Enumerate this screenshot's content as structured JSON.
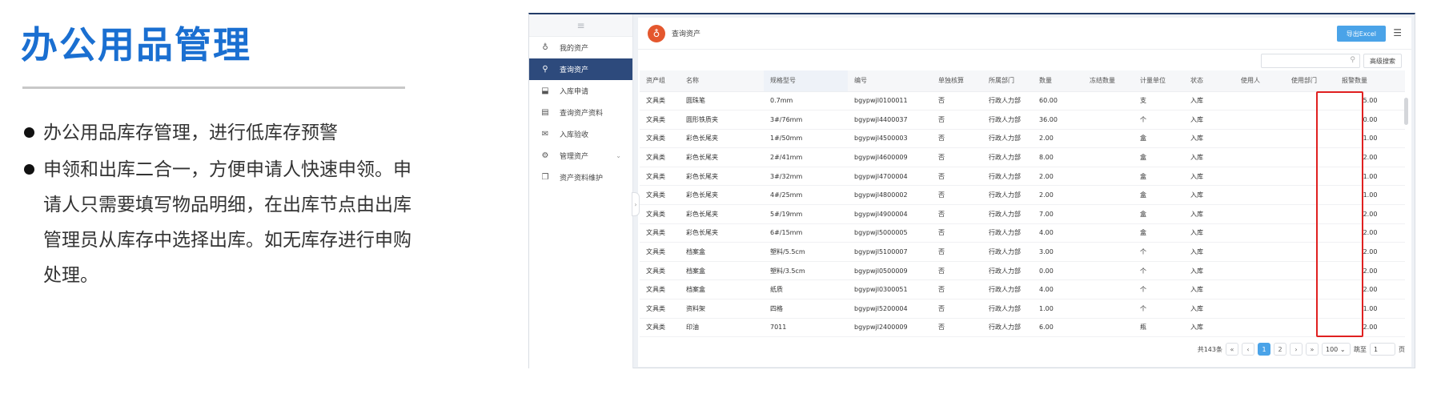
{
  "slide": {
    "title": "办公用品管理",
    "bullets": [
      "办公用品库存管理，进行低库存预警",
      "申领和出库二合一，方便申请人快速申领。申请人只需要填写物品明细，在出库节点由出库管理员从库存中选择出库。如无库存进行申购处理。"
    ]
  },
  "app": {
    "sidebar": {
      "top_icon": "≡",
      "items": [
        {
          "label": "我的资产",
          "icon": "money-bag-icon",
          "glyph": "♁"
        },
        {
          "label": "查询资产",
          "icon": "search-icon",
          "glyph": "⚲",
          "active": true
        },
        {
          "label": "入库申请",
          "icon": "inbox-icon",
          "glyph": "⬓"
        },
        {
          "label": "查询资产资料",
          "icon": "document-icon",
          "glyph": "▤"
        },
        {
          "label": "入库验收",
          "icon": "mail-icon",
          "glyph": "✉"
        },
        {
          "label": "管理资产",
          "icon": "gear-icon",
          "glyph": "⚙",
          "chevron": "⌄"
        },
        {
          "label": "资产资料维护",
          "icon": "files-icon",
          "glyph": "❐"
        }
      ]
    },
    "header": {
      "title": "查询资产",
      "logo_glyph": "♁",
      "export_label": "导出Excel",
      "menu_icon": "☰"
    },
    "search": {
      "placeholder": "",
      "search_icon": "⚲",
      "advanced_label": "高级搜索"
    },
    "table": {
      "columns": [
        "资产组",
        "名称",
        "规格型号",
        "编号",
        "单独核算",
        "所属部门",
        "数量",
        "冻结数量",
        "计量单位",
        "状态",
        "使用人",
        "使用部门",
        "报警数量"
      ],
      "rows": [
        [
          "文具类",
          "圆珠笔",
          "0.7mm",
          "bgypwjl0100011",
          "否",
          "行政人力部",
          "60.00",
          "",
          "支",
          "入库",
          "",
          "",
          "5.00"
        ],
        [
          "文具类",
          "圆形铁质夹",
          "3#/76mm",
          "bgypwjl4400037",
          "否",
          "行政人力部",
          "36.00",
          "",
          "个",
          "入库",
          "",
          "",
          "0.00"
        ],
        [
          "文具类",
          "彩色长尾夹",
          "1#/50mm",
          "bgypwjl4500003",
          "否",
          "行政人力部",
          "2.00",
          "",
          "盒",
          "入库",
          "",
          "",
          "1.00"
        ],
        [
          "文具类",
          "彩色长尾夹",
          "2#/41mm",
          "bgypwjl4600009",
          "否",
          "行政人力部",
          "8.00",
          "",
          "盒",
          "入库",
          "",
          "",
          "2.00"
        ],
        [
          "文具类",
          "彩色长尾夹",
          "3#/32mm",
          "bgypwjl4700004",
          "否",
          "行政人力部",
          "2.00",
          "",
          "盒",
          "入库",
          "",
          "",
          "1.00"
        ],
        [
          "文具类",
          "彩色长尾夹",
          "4#/25mm",
          "bgypwjl4800002",
          "否",
          "行政人力部",
          "2.00",
          "",
          "盒",
          "入库",
          "",
          "",
          "1.00"
        ],
        [
          "文具类",
          "彩色长尾夹",
          "5#/19mm",
          "bgypwjl4900004",
          "否",
          "行政人力部",
          "7.00",
          "",
          "盒",
          "入库",
          "",
          "",
          "2.00"
        ],
        [
          "文具类",
          "彩色长尾夹",
          "6#/15mm",
          "bgypwjl5000005",
          "否",
          "行政人力部",
          "4.00",
          "",
          "盒",
          "入库",
          "",
          "",
          "2.00"
        ],
        [
          "文具类",
          "档案盒",
          "塑料/5.5cm",
          "bgypwjl5100007",
          "否",
          "行政人力部",
          "3.00",
          "",
          "个",
          "入库",
          "",
          "",
          "2.00"
        ],
        [
          "文具类",
          "档案盒",
          "塑料/3.5cm",
          "bgypwjl0500009",
          "否",
          "行政人力部",
          "0.00",
          "",
          "个",
          "入库",
          "",
          "",
          "2.00"
        ],
        [
          "文具类",
          "档案盒",
          "纸质",
          "bgypwjl0300051",
          "否",
          "行政人力部",
          "4.00",
          "",
          "个",
          "入库",
          "",
          "",
          "2.00"
        ],
        [
          "文具类",
          "资料架",
          "四格",
          "bgypwjl5200004",
          "否",
          "行政人力部",
          "1.00",
          "",
          "个",
          "入库",
          "",
          "",
          "1.00"
        ],
        [
          "文具类",
          "印油",
          "7011",
          "bgypwjl2400009",
          "否",
          "行政人力部",
          "6.00",
          "",
          "瓶",
          "入库",
          "",
          "",
          "2.00"
        ]
      ]
    },
    "pager": {
      "total": "共143条",
      "first": "«",
      "prev": "‹",
      "pages": [
        "1",
        "2"
      ],
      "next": "›",
      "last": "»",
      "page_size": "100 ⌄",
      "jump_label": "跳至",
      "jump_value": "1",
      "page_suffix": "页"
    },
    "collapse_glyph": "›"
  }
}
